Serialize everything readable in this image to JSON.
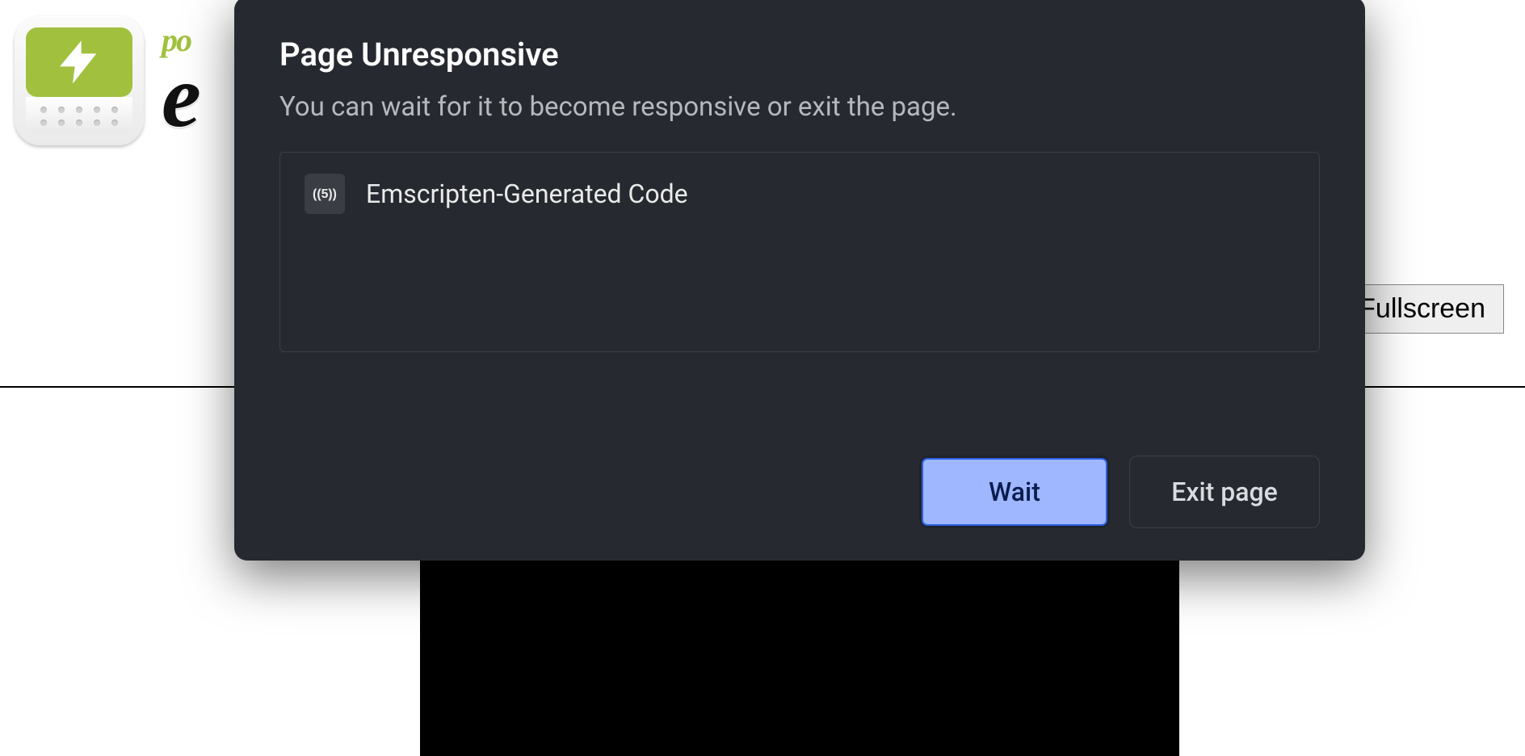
{
  "page": {
    "brand_small": "po",
    "brand_big": "e",
    "fullscreen_label": "Fullscreen"
  },
  "dialog": {
    "title": "Page Unresponsive",
    "message": "You can wait for it to become responsive or exit the page.",
    "tab_title": "Emscripten-Generated Code",
    "favicon_label": "5",
    "wait_label": "Wait",
    "exit_label": "Exit page"
  }
}
